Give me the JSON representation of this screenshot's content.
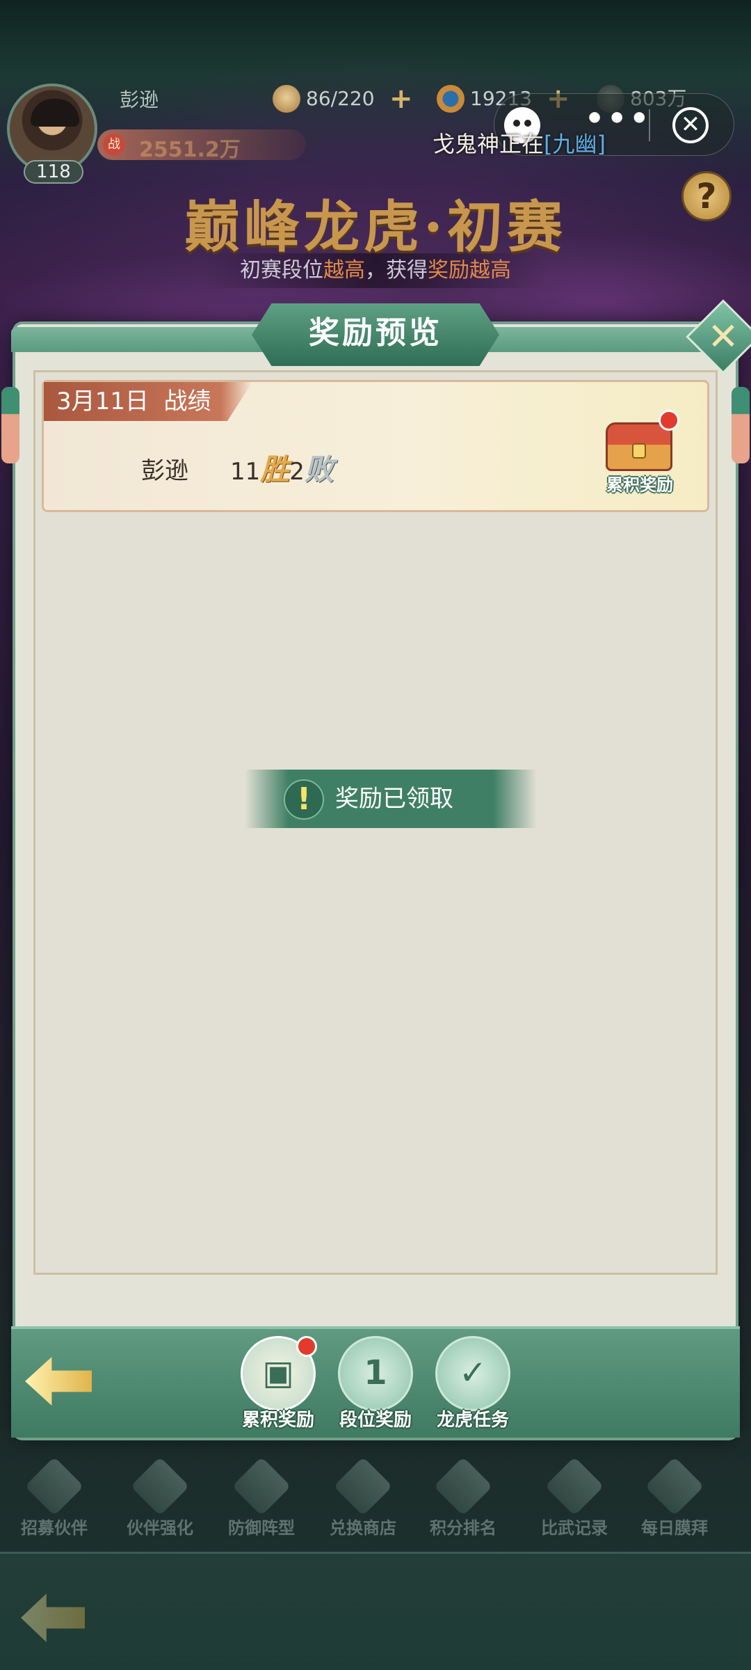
{
  "player": {
    "name": "彭逊",
    "level": "118",
    "power_badge": "战",
    "power": "2551.2万"
  },
  "resources": {
    "stamina": "86/220",
    "gems": "19213",
    "coins": "803万"
  },
  "capsule": {
    "more": "•••",
    "close": "✕"
  },
  "marquee": {
    "text": "戈鬼神正在",
    "highlight": "[九幽]"
  },
  "event": {
    "title": "巅峰龙虎·初赛",
    "subtitle_a": "初赛段位",
    "subtitle_b": "越高",
    "subtitle_c": "，获得",
    "subtitle_d": "奖励越高",
    "help": "?"
  },
  "modal": {
    "title": "奖励预览",
    "close": "✕",
    "record": {
      "date": "3月11日",
      "label": "战绩",
      "name": "彭逊",
      "wins": "11",
      "win_char": "胜",
      "losses": "2",
      "lose_char": "败",
      "chest_label": "累积奖励"
    },
    "toast": {
      "icon": "!",
      "text": "奖励已领取"
    },
    "tabs": [
      {
        "label": "累积奖励",
        "icon": "chest-icon",
        "glyph": "▣"
      },
      {
        "label": "段位奖励",
        "icon": "podium-icon",
        "glyph": "1"
      },
      {
        "label": "龙虎任务",
        "icon": "scroll-check-icon",
        "glyph": "✓"
      }
    ]
  },
  "bottom_nav": [
    {
      "label": "招募伙伴"
    },
    {
      "label": "伙伴强化"
    },
    {
      "label": "防御阵型"
    },
    {
      "label": "兑换商店"
    },
    {
      "label": "积分排名"
    },
    {
      "label": "比武记录"
    },
    {
      "label": "每日膜拜"
    }
  ]
}
